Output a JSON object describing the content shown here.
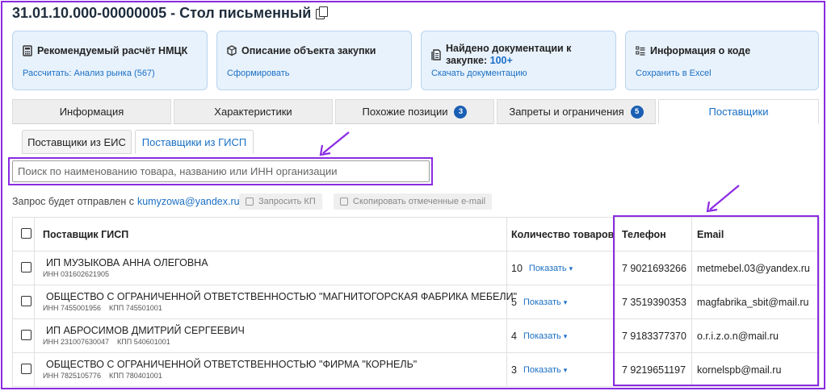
{
  "title": "31.01.10.000-00000005 - Стол письменный",
  "cards": [
    {
      "title": "Рекомендуемый расчёт НМЦК",
      "link": "Рассчитать: Анализ рынка (567)",
      "icon": "calculator-icon"
    },
    {
      "title": "Описание объекта закупки",
      "link": "Сформировать",
      "icon": "box-icon"
    },
    {
      "title_part1": "Найдено документации к закупке:",
      "title_highlight": "100+",
      "link": "Скачать документацию",
      "icon": "document-icon"
    },
    {
      "title": "Информация о коде",
      "link": "Сохранить в Excel",
      "icon": "list-icon"
    }
  ],
  "tabs": [
    {
      "label": "Информация",
      "badge": ""
    },
    {
      "label": "Характеристики",
      "badge": ""
    },
    {
      "label": "Похожие позиции",
      "badge": "3"
    },
    {
      "label": "Запреты и ограничения",
      "badge": "5"
    },
    {
      "label": "Поставщики",
      "badge": ""
    }
  ],
  "subtabs": [
    "Поставщики из ЕИС",
    "Поставщики из ГИСП"
  ],
  "search": {
    "placeholder": "Поиск по наименованию товара, названию или ИНН организации",
    "value": ""
  },
  "request": {
    "prefix": "Запрос будет отправлен с",
    "email": "kumyzowa@yandex.ru",
    "request_kp": "Запросить КП",
    "copy_emails": "Скопировать отмеченные e-mail"
  },
  "table": {
    "headers": {
      "supplier": "Поставщик ГИСП",
      "qty": "Количество товаров",
      "phone": "Телефон",
      "email": "Email"
    },
    "show_label": "Показать",
    "rows": [
      {
        "name": "ИП МУЗЫКОВА АННА ОЛЕГОВНА",
        "inn": "ИНН 031602621905",
        "kpp": "",
        "qty": "10",
        "phone": "7 9021693266",
        "email": "metmebel.03@yandex.ru"
      },
      {
        "name": "ОБЩЕСТВО С ОГРАНИЧЕННОЙ ОТВЕТСТВЕННОСТЬЮ \"МАГНИТОГОРСКАЯ ФАБРИКА МЕБЕЛИ\"",
        "inn": "ИНН 7455001956",
        "kpp": "КПП 745501001",
        "qty": "5",
        "phone": "7 3519390353",
        "email": "magfabrika_sbit@mail.ru"
      },
      {
        "name": "ИП АБРОСИМОВ ДМИТРИЙ СЕРГЕЕВИЧ",
        "inn": "ИНН 231007630047",
        "kpp": "КПП 540601001",
        "qty": "4",
        "phone": "7 9183377370",
        "email": "o.r.i.z.o.n@mail.ru"
      },
      {
        "name": "ОБЩЕСТВО С ОГРАНИЧЕННОЙ ОТВЕТСТВЕННОСТЬЮ \"ФИРМА \"КОРНЕЛЬ\"",
        "inn": "ИНН 7825105776",
        "kpp": "КПП 780401001",
        "qty": "3",
        "phone": "7 9219651197",
        "email": "kornelspb@mail.ru"
      }
    ]
  },
  "colors": {
    "accent": "#1a6fc4",
    "highlight": "#8a2be2",
    "card_bg": "#e8f2fc"
  }
}
